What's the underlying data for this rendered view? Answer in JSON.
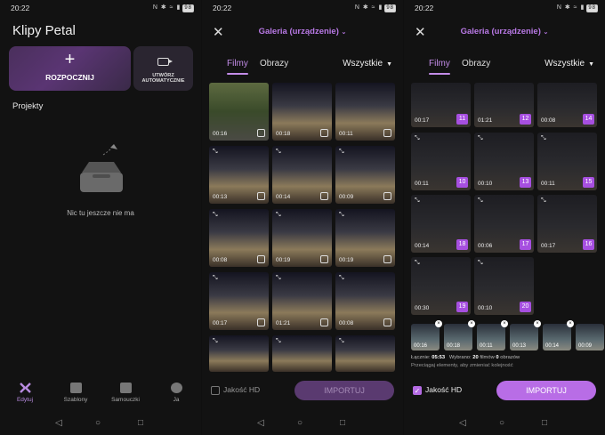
{
  "status": {
    "time": "20:22",
    "icons": "N ✱ ≈ ▮",
    "battery": "98"
  },
  "screen1": {
    "title": "Klipy Petal",
    "start": {
      "plus": "+",
      "label": "ROZPOCZNIJ"
    },
    "auto": {
      "label": "UTWÓRZ AUTOMATYCZNIE"
    },
    "projects_heading": "Projekty",
    "empty_text": "Nic tu jeszcze nie ma",
    "nav": [
      {
        "label": "Edytuj",
        "icon": "edit-icon"
      },
      {
        "label": "Szablony",
        "icon": "templates-icon"
      },
      {
        "label": "Samouczki",
        "icon": "tutorials-icon"
      },
      {
        "label": "Ja",
        "icon": "profile-icon"
      }
    ]
  },
  "gallery": {
    "close": "✕",
    "title": "Galeria (urządzenie)",
    "tabs": [
      "Filmy",
      "Obrazy"
    ],
    "filter": "Wszystkie",
    "hd_label": "Jakość HD",
    "import_label": "IMPORTUJ"
  },
  "screen2": {
    "durations": [
      "00:16",
      "00:18",
      "00:11",
      "00:13",
      "00:14",
      "00:09",
      "00:08",
      "00:19",
      "00:19",
      "00:17",
      "01:21",
      "00:08",
      "",
      "",
      ""
    ]
  },
  "screen3": {
    "cells": [
      {
        "dur": "00:17",
        "num": "11"
      },
      {
        "dur": "01:21",
        "num": "12"
      },
      {
        "dur": "00:08",
        "num": "14"
      },
      {
        "dur": "00:11",
        "num": "10"
      },
      {
        "dur": "00:10",
        "num": "13"
      },
      {
        "dur": "00:11",
        "num": "15"
      },
      {
        "dur": "00:14",
        "num": "18"
      },
      {
        "dur": "00:06",
        "num": "17"
      },
      {
        "dur": "00:17",
        "num": "16"
      },
      {
        "dur": "00:30",
        "num": "19"
      },
      {
        "dur": "00:10",
        "num": "20"
      }
    ],
    "strip": [
      "00:16",
      "00:18",
      "00:11",
      "00:13",
      "00:14",
      "00:09"
    ],
    "summary_total_label": "Łącznie:",
    "summary_total": "05:53",
    "summary_selected_label": "Wybrano:",
    "summary_films": "20",
    "summary_films_label": "filmów",
    "summary_images": "0",
    "summary_images_label": "obrazów",
    "hint": "Przeciągaj elementy, aby zmieniać kolejność"
  },
  "sysnav": {
    "back": "◁",
    "home": "○",
    "recent": "□"
  },
  "colors": {
    "accent": "#b86de6",
    "background": "#121212"
  }
}
